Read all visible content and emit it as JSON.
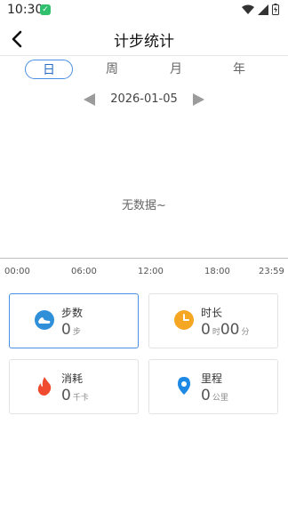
{
  "status_bar": {
    "time": "10:30"
  },
  "header": {
    "title": "计步统计"
  },
  "tabs": [
    {
      "label": "日",
      "active": true
    },
    {
      "label": "周",
      "active": false
    },
    {
      "label": "月",
      "active": false
    },
    {
      "label": "年",
      "active": false
    }
  ],
  "date_nav": {
    "date": "2026-01-05"
  },
  "chart": {
    "empty_text": "无数据~",
    "x_labels": [
      "00:00",
      "06:00",
      "12:00",
      "18:00",
      "23:59"
    ]
  },
  "cards": {
    "steps": {
      "label": "步数",
      "value": "0",
      "unit": "步"
    },
    "duration": {
      "label": "时长",
      "hours": "0",
      "hours_unit": "时",
      "minutes": "00",
      "minutes_unit": "分"
    },
    "calories": {
      "label": "消耗",
      "value": "0",
      "unit": "千卡"
    },
    "distance": {
      "label": "里程",
      "value": "0",
      "unit": "公里"
    }
  },
  "colors": {
    "accent": "#4a90e2",
    "steps_icon": "#2f8fd8",
    "clock_icon": "#f5a623",
    "fire_icon": "#f04b2f",
    "location_icon": "#1e88e5"
  }
}
